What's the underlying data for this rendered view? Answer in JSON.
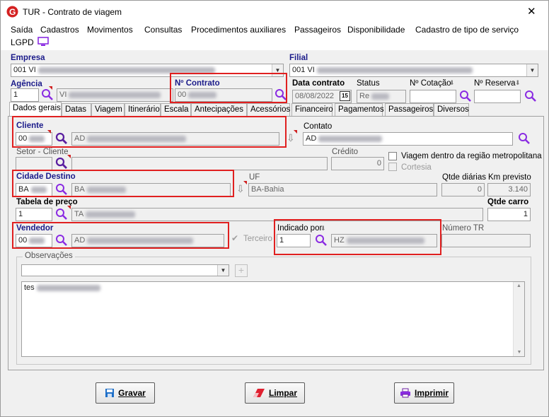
{
  "window": {
    "title": "TUR - Contrato de viagem",
    "close": "✕"
  },
  "menu": [
    "Saída",
    "Cadastros",
    "Movimentos",
    "Consultas",
    "Procedimentos auxiliares",
    "Passageiros",
    "Disponibilidade",
    "Cadastro de tipo de serviço",
    "LGPD"
  ],
  "header": {
    "empresa_label": "Empresa",
    "empresa_value": "001 VI",
    "filial_label": "Filial",
    "filial_value": "001 VI",
    "agencia_label": "Agência",
    "agencia_value": "1",
    "agencia_name": "VI",
    "contrato_label": "Nº Contrato",
    "contrato_value": "00",
    "data_label": "Data contrato",
    "data_value": "08/08/2022",
    "cal_icon": "15",
    "status_label": "Status",
    "status_value": "Re",
    "cotacao_label": "Nº Cotação",
    "reserva_label": "Nº Reserva"
  },
  "tabs": [
    "Dados gerais",
    "Datas",
    "Viagem",
    "Itinerário",
    "Escala",
    "Antecipações",
    "Acessórios",
    "Financeiro",
    "Pagamentos",
    "Passageiros",
    "Diversos"
  ],
  "form": {
    "cliente_label": "Cliente",
    "cliente_code": "00",
    "cliente_name": "AD",
    "contato_label": "Contato",
    "contato_value": "AD",
    "setor_label": "Setor - Cliente",
    "credito_label": "Crédito",
    "credito_value": "0",
    "metro_label": "Viagem dentro da região metropolitana",
    "cortesia_label": "Cortesia",
    "cidade_label": "Cidade Destino",
    "cidade_code": "BA",
    "cidade_name": "BA",
    "uf_label": "UF",
    "uf_value": "BA-Bahia",
    "diarias_label": "Qtde diárias",
    "diarias_value": "0",
    "km_label": "Km previsto",
    "km_value": "3.140",
    "tabela_label": "Tabela de preço",
    "tabela_code": "1",
    "tabela_name": "TA",
    "carro_label": "Qtde carro",
    "carro_value": "1",
    "vendedor_label": "Vendedor",
    "vendedor_code": "00",
    "vendedor_name": "AD",
    "terceiro_label": "Terceiro",
    "indicado_label": "Indicado por",
    "indicado_code": "1",
    "indicado_name": "HZ",
    "numtr_label": "Número TR",
    "obs_label": "Observações",
    "obs_text": "tes"
  },
  "buttons": {
    "gravar": "Gravar",
    "limpar": "Limpar",
    "imprimir": "Imprimir"
  },
  "colors": {
    "highlight": "#e02020",
    "search_icon": "#8a2be2",
    "label_navy": "#1b1b8a"
  }
}
